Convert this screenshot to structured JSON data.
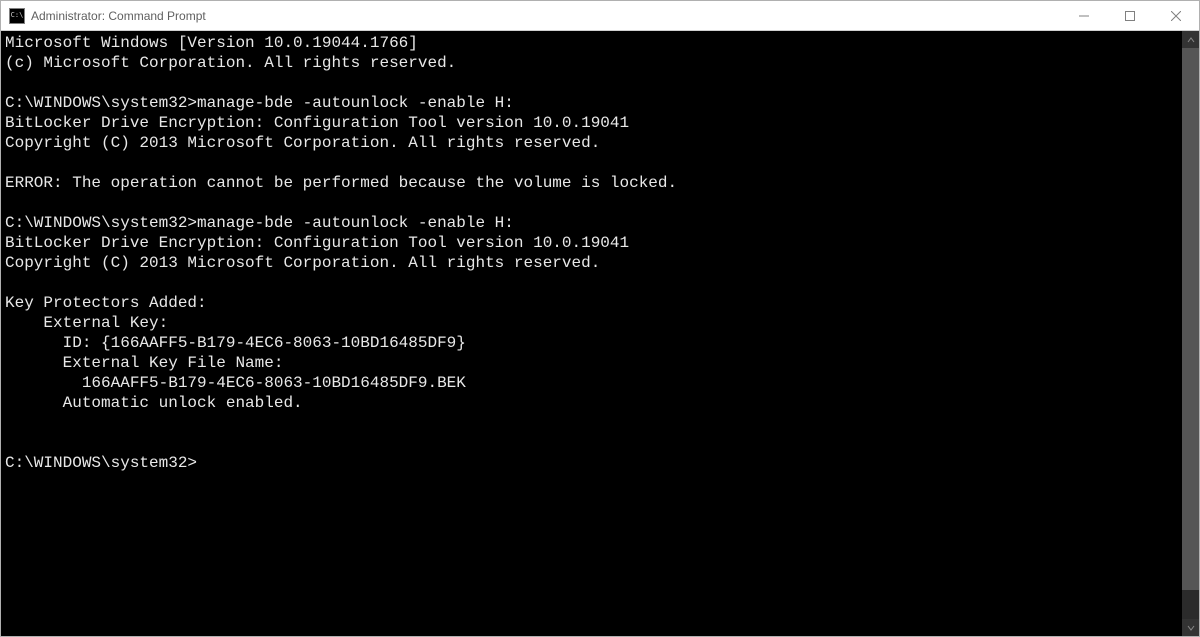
{
  "window": {
    "title": "Administrator: Command Prompt"
  },
  "terminal": {
    "lines": [
      "Microsoft Windows [Version 10.0.19044.1766]",
      "(c) Microsoft Corporation. All rights reserved.",
      "",
      "C:\\WINDOWS\\system32>manage-bde -autounlock -enable H:",
      "BitLocker Drive Encryption: Configuration Tool version 10.0.19041",
      "Copyright (C) 2013 Microsoft Corporation. All rights reserved.",
      "",
      "ERROR: The operation cannot be performed because the volume is locked.",
      "",
      "C:\\WINDOWS\\system32>manage-bde -autounlock -enable H:",
      "BitLocker Drive Encryption: Configuration Tool version 10.0.19041",
      "Copyright (C) 2013 Microsoft Corporation. All rights reserved.",
      "",
      "Key Protectors Added:",
      "    External Key:",
      "      ID: {166AAFF5-B179-4EC6-8063-10BD16485DF9}",
      "      External Key File Name:",
      "        166AAFF5-B179-4EC6-8063-10BD16485DF9.BEK",
      "      Automatic unlock enabled.",
      "",
      "",
      "C:\\WINDOWS\\system32>"
    ]
  }
}
